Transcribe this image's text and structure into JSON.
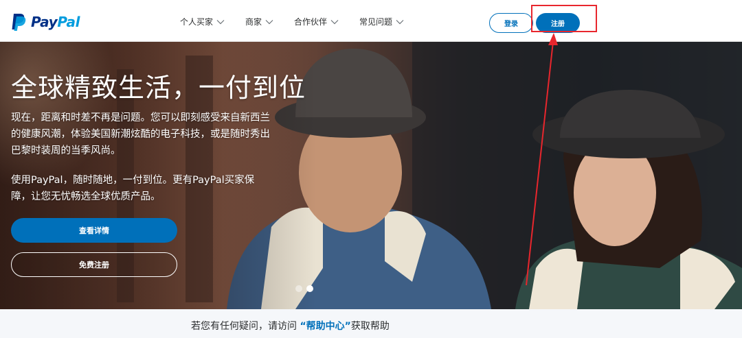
{
  "brand": {
    "name_part1": "Pay",
    "name_part2": "Pal",
    "primary_color": "#003087",
    "secondary_color": "#009cde"
  },
  "nav": {
    "items": [
      {
        "label": "个人买家"
      },
      {
        "label": "商家"
      },
      {
        "label": "合作伙伴"
      },
      {
        "label": "常见问题"
      }
    ]
  },
  "header": {
    "login_label": "登录",
    "signup_label": "注册"
  },
  "hero": {
    "title": "全球精致生活，一付到位",
    "paragraph1": "现在，距离和时差不再是问题。您可以即刻感受来自新西兰的健康风潮，体验美国新潮炫酷的电子科技，或是随时秀出巴黎时装周的当季风尚。",
    "paragraph2": "使用PayPal，随时随地，一付到位。更有PayPal买家保障，让您无忧畅选全球优质产品。",
    "details_button": "查看详情",
    "free_signup_button": "免费注册"
  },
  "carousel": {
    "slide_count": 2,
    "active_index": 1
  },
  "help": {
    "prefix": "若您有任何疑问，请访问 ",
    "link": "“帮助中心”",
    "suffix": "获取帮助"
  },
  "colors": {
    "accent": "#0070ba",
    "annotation": "#e8262d",
    "help_bg": "#f5f7fa"
  }
}
